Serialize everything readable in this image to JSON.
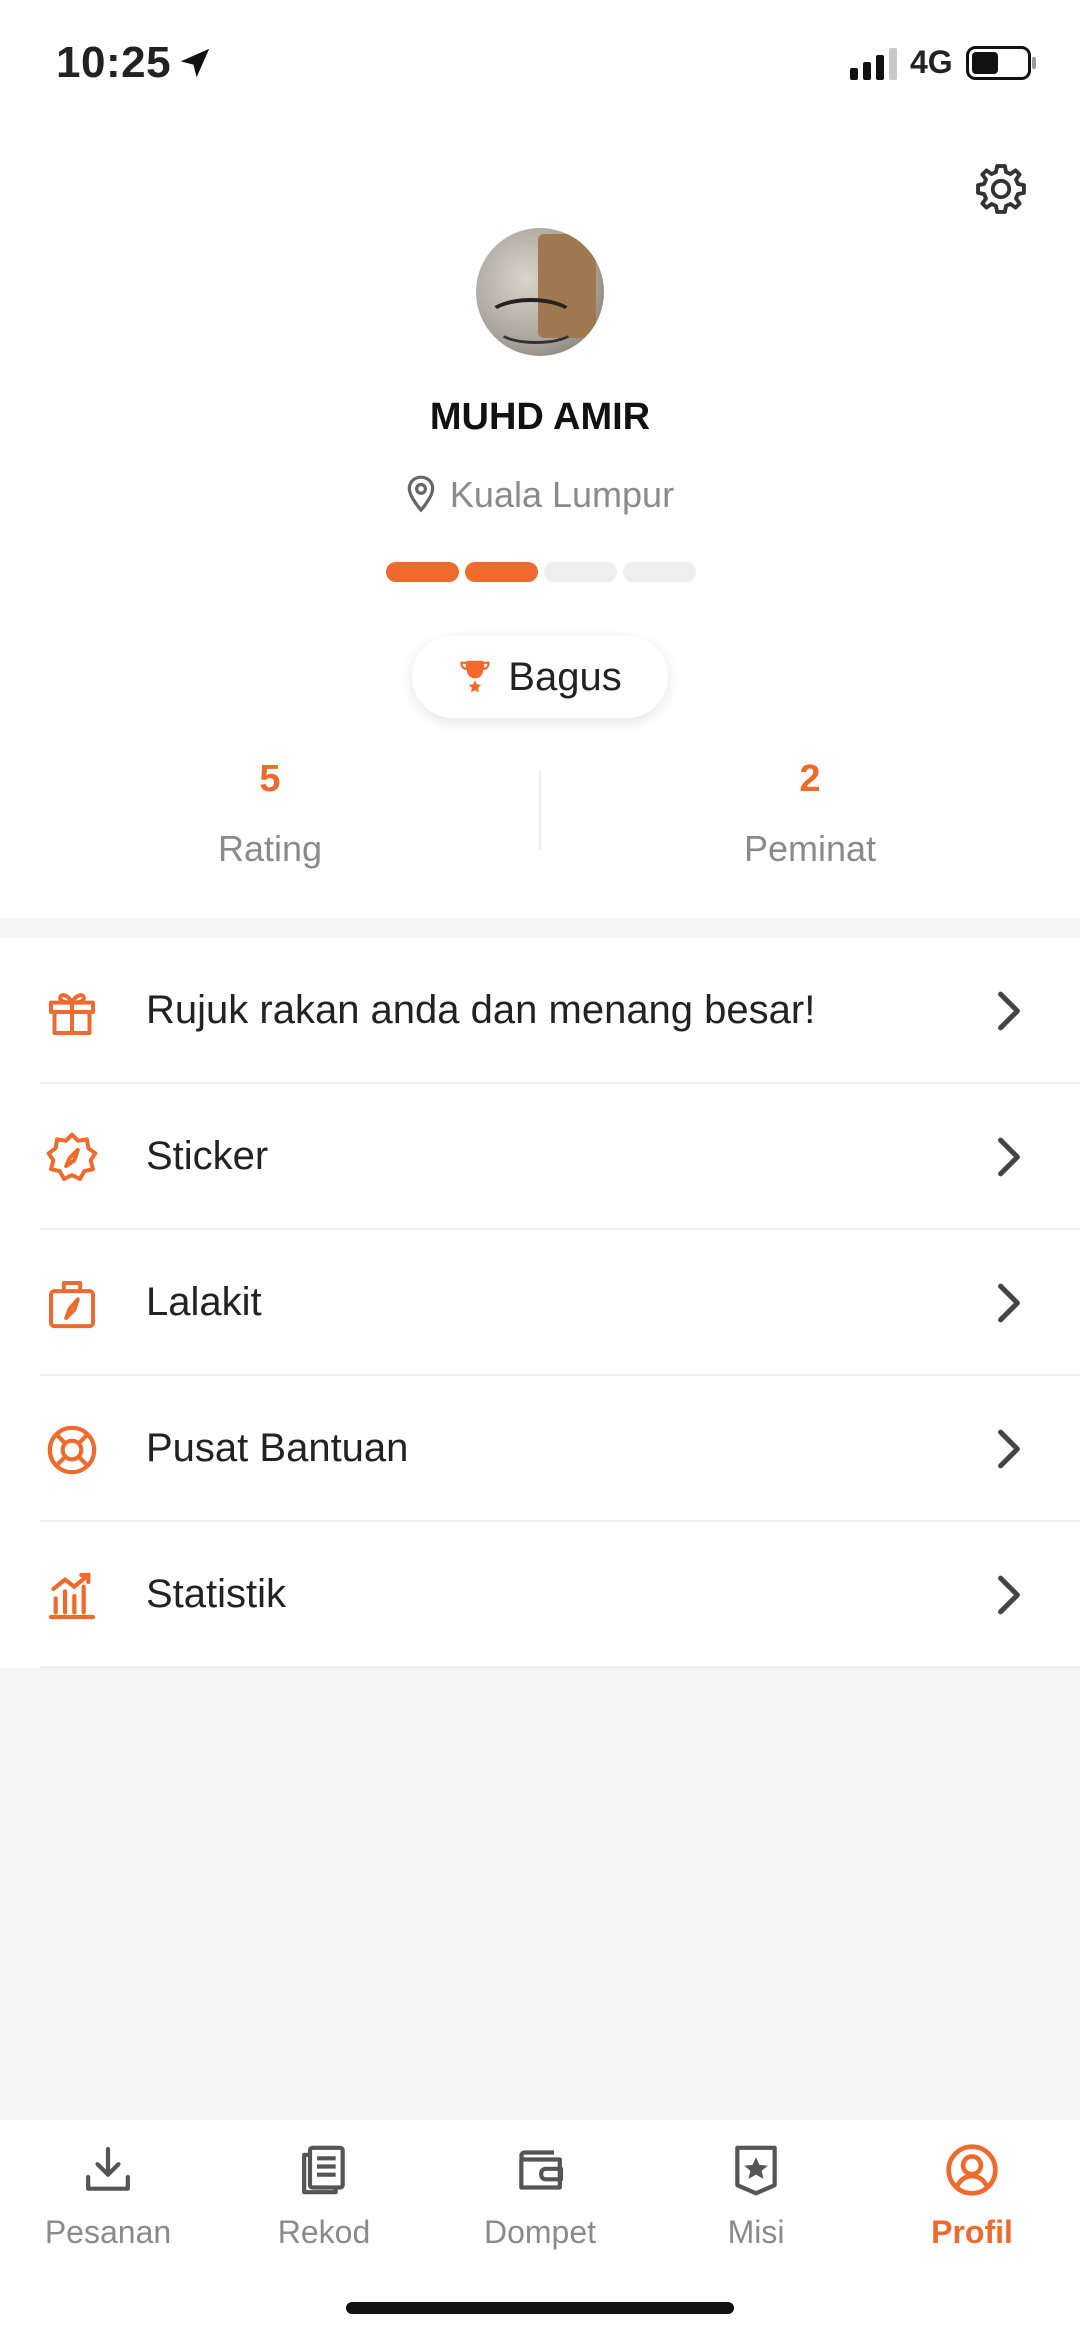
{
  "status_bar": {
    "time": "10:25",
    "network": "4G"
  },
  "profile": {
    "name": "MUHD AMIR",
    "location": "Kuala Lumpur",
    "level_segments_filled": 2,
    "level_segments_total": 4,
    "badge": "Bagus"
  },
  "stats": [
    {
      "value": "5",
      "label": "Rating"
    },
    {
      "value": "2",
      "label": "Peminat"
    }
  ],
  "menu": [
    {
      "label": "Rujuk rakan anda dan menang besar!",
      "icon": "gift-icon"
    },
    {
      "label": "Sticker",
      "icon": "sticker-badge-icon"
    },
    {
      "label": "Lalakit",
      "icon": "kit-bag-icon"
    },
    {
      "label": "Pusat Bantuan",
      "icon": "lifebuoy-icon"
    },
    {
      "label": "Statistik",
      "icon": "statistics-chart-icon"
    }
  ],
  "tabs": [
    {
      "label": "Pesanan",
      "icon": "download-icon",
      "active": false
    },
    {
      "label": "Rekod",
      "icon": "records-icon",
      "active": false
    },
    {
      "label": "Dompet",
      "icon": "wallet-icon",
      "active": false
    },
    {
      "label": "Misi",
      "icon": "mission-star-icon",
      "active": false
    },
    {
      "label": "Profil",
      "icon": "profile-icon",
      "active": true
    }
  ],
  "colors": {
    "accent": "#ee6a2d",
    "muted_text": "#8a8a8a",
    "background": "#f5f5f5"
  }
}
